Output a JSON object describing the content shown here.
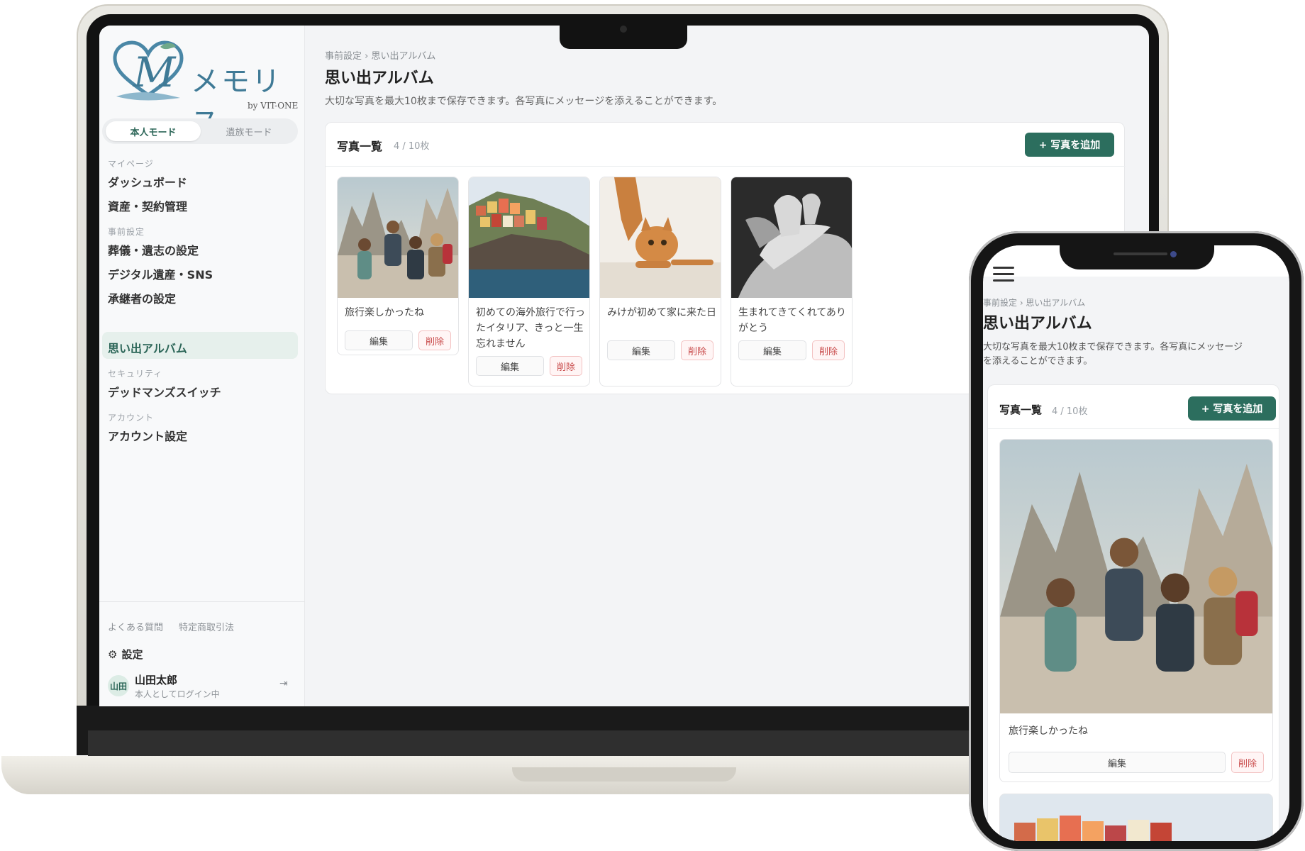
{
  "app": {
    "logo_text": "メモリス",
    "logo_sub": "by VIT-ONE"
  },
  "sidebar": {
    "mode_self": "本人モード",
    "mode_family": "遺族モード",
    "sections": [
      {
        "label": "マイページ",
        "items": [
          "ダッシュボード",
          "資産・契約管理"
        ]
      },
      {
        "label": "事前設定",
        "items": [
          "葬儀・遺志の設定",
          "デジタル遺産・SNS",
          "承継者の設定",
          "思い出アルバム"
        ]
      },
      {
        "label": "セキュリティ",
        "items": [
          "デッドマンズスイッチ"
        ]
      },
      {
        "label": "アカウント",
        "items": [
          "アカウント設定"
        ]
      }
    ],
    "footer_links": [
      "よくある質問",
      "特定商取引法"
    ],
    "settings": "設定",
    "user": {
      "avatar": "山田",
      "name": "山田太郎",
      "status": "本人としてログイン中"
    }
  },
  "page": {
    "breadcrumb": "事前設定 › 思い出アルバム",
    "title": "思い出アルバム",
    "description": "大切な写真を最大10枚まで保存できます。各写真にメッセージを添えることができます。",
    "description_mobile_1": "大切な写真を最大10枚まで保存できます。各写真にメッセージ",
    "description_mobile_2": "を添えることができます。",
    "list_title": "写真一覧",
    "list_count": "4 / 10枚",
    "add_button": "+ 写真を追加",
    "edit_label": "編集",
    "delete_label": "削除",
    "photos": [
      {
        "caption": "旅行楽しかったね"
      },
      {
        "caption": "初めての海外旅行で行ったイタリア、きっと一生忘れません"
      },
      {
        "caption": "みけが初めて家に来た日"
      },
      {
        "caption": "生まれてきてくれてありがとう"
      }
    ]
  },
  "colors": {
    "accent": "#2c6e5e",
    "danger": "#c94b4b",
    "logo": "#3f7a96"
  }
}
